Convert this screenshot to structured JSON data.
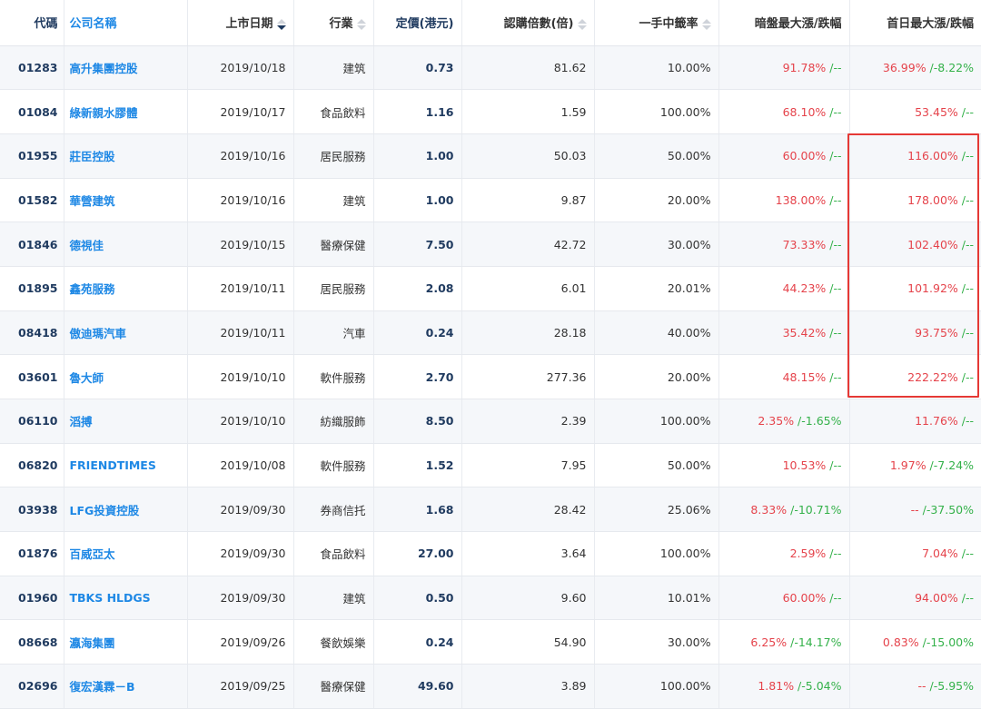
{
  "table": {
    "headers": {
      "code": "代碼",
      "name": "公司名稱",
      "date": "上市日期",
      "industry": "行業",
      "price": "定價(港元)",
      "subscription": "認購倍數(倍)",
      "lot_rate": "一手中籤率",
      "grey_market": "暗盤最大漲/跌幅",
      "first_day": "首日最大漲/跌幅"
    },
    "sort": {
      "active_column": "date",
      "direction": "descending"
    },
    "rows": [
      {
        "code": "01283",
        "name": "高升集團控股",
        "date": "2019/10/18",
        "industry": "建筑",
        "price": "0.73",
        "subscription": "81.62",
        "lot_rate": "10.00%",
        "grey_up": "91.78%",
        "grey_down": "--",
        "first_up": "36.99%",
        "first_down": "-8.22%"
      },
      {
        "code": "01084",
        "name": "綠新親水膠體",
        "date": "2019/10/17",
        "industry": "食品飲料",
        "price": "1.16",
        "subscription": "1.59",
        "lot_rate": "100.00%",
        "grey_up": "68.10%",
        "grey_down": "--",
        "first_up": "53.45%",
        "first_down": "--"
      },
      {
        "code": "01955",
        "name": "莊臣控股",
        "date": "2019/10/16",
        "industry": "居民服務",
        "price": "1.00",
        "subscription": "50.03",
        "lot_rate": "50.00%",
        "grey_up": "60.00%",
        "grey_down": "--",
        "first_up": "116.00%",
        "first_down": "--"
      },
      {
        "code": "01582",
        "name": "華營建筑",
        "date": "2019/10/16",
        "industry": "建筑",
        "price": "1.00",
        "subscription": "9.87",
        "lot_rate": "20.00%",
        "grey_up": "138.00%",
        "grey_down": "--",
        "first_up": "178.00%",
        "first_down": "--"
      },
      {
        "code": "01846",
        "name": "德視佳",
        "date": "2019/10/15",
        "industry": "醫療保健",
        "price": "7.50",
        "subscription": "42.72",
        "lot_rate": "30.00%",
        "grey_up": "73.33%",
        "grey_down": "--",
        "first_up": "102.40%",
        "first_down": "--"
      },
      {
        "code": "01895",
        "name": "鑫苑服務",
        "date": "2019/10/11",
        "industry": "居民服務",
        "price": "2.08",
        "subscription": "6.01",
        "lot_rate": "20.01%",
        "grey_up": "44.23%",
        "grey_down": "--",
        "first_up": "101.92%",
        "first_down": "--"
      },
      {
        "code": "08418",
        "name": "傲迪瑪汽車",
        "date": "2019/10/11",
        "industry": "汽車",
        "price": "0.24",
        "subscription": "28.18",
        "lot_rate": "40.00%",
        "grey_up": "35.42%",
        "grey_down": "--",
        "first_up": "93.75%",
        "first_down": "--"
      },
      {
        "code": "03601",
        "name": "魯大師",
        "date": "2019/10/10",
        "industry": "軟件服務",
        "price": "2.70",
        "subscription": "277.36",
        "lot_rate": "20.00%",
        "grey_up": "48.15%",
        "grey_down": "--",
        "first_up": "222.22%",
        "first_down": "--"
      },
      {
        "code": "06110",
        "name": "滔搏",
        "date": "2019/10/10",
        "industry": "紡織服飾",
        "price": "8.50",
        "subscription": "2.39",
        "lot_rate": "100.00%",
        "grey_up": "2.35%",
        "grey_down": "-1.65%",
        "first_up": "11.76%",
        "first_down": "--"
      },
      {
        "code": "06820",
        "name": "FRIENDTIMES",
        "date": "2019/10/08",
        "industry": "軟件服務",
        "price": "1.52",
        "subscription": "7.95",
        "lot_rate": "50.00%",
        "grey_up": "10.53%",
        "grey_down": "--",
        "first_up": "1.97%",
        "first_down": "-7.24%"
      },
      {
        "code": "03938",
        "name": "LFG投資控股",
        "date": "2019/09/30",
        "industry": "券商信托",
        "price": "1.68",
        "subscription": "28.42",
        "lot_rate": "25.06%",
        "grey_up": "8.33%",
        "grey_down": "-10.71%",
        "first_up": "--",
        "first_down": "-37.50%"
      },
      {
        "code": "01876",
        "name": "百威亞太",
        "date": "2019/09/30",
        "industry": "食品飲料",
        "price": "27.00",
        "subscription": "3.64",
        "lot_rate": "100.00%",
        "grey_up": "2.59%",
        "grey_down": "--",
        "first_up": "7.04%",
        "first_down": "--"
      },
      {
        "code": "01960",
        "name": "TBKS HLDGS",
        "date": "2019/09/30",
        "industry": "建筑",
        "price": "0.50",
        "subscription": "9.60",
        "lot_rate": "10.01%",
        "grey_up": "60.00%",
        "grey_down": "--",
        "first_up": "94.00%",
        "first_down": "--"
      },
      {
        "code": "08668",
        "name": "瀛海集團",
        "date": "2019/09/26",
        "industry": "餐飲娛樂",
        "price": "0.24",
        "subscription": "54.90",
        "lot_rate": "30.00%",
        "grey_up": "6.25%",
        "grey_down": "-14.17%",
        "first_up": "0.83%",
        "first_down": "-15.00%"
      },
      {
        "code": "02696",
        "name": "復宏漢霖－B",
        "date": "2019/09/25",
        "industry": "醫療保健",
        "price": "49.60",
        "subscription": "3.89",
        "lot_rate": "100.00%",
        "grey_up": "1.81%",
        "grey_down": "-5.04%",
        "first_up": "--",
        "first_down": "-5.95%"
      }
    ]
  },
  "colors": {
    "up": "#e5434b",
    "down": "#34b14a",
    "link": "#1e88e5",
    "highlight": "#e53935"
  },
  "separator": " /"
}
